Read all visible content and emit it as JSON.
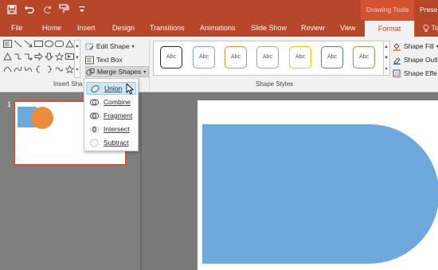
{
  "quick_access": {
    "save_icon": "save-icon",
    "undo_icon": "undo-icon",
    "redo_icon": "redo-icon",
    "format_painter_icon": "format-painter-icon",
    "customize_icon": "customize-qat-icon"
  },
  "contextual_tab_group": "Drawing Tools",
  "window_title_partial": "Prese",
  "tabs": [
    {
      "label": "File"
    },
    {
      "label": "Home"
    },
    {
      "label": "Insert"
    },
    {
      "label": "Design"
    },
    {
      "label": "Transitions"
    },
    {
      "label": "Animations"
    },
    {
      "label": "Slide Show"
    },
    {
      "label": "Review"
    },
    {
      "label": "View"
    },
    {
      "label": "Format"
    }
  ],
  "active_tab": "Format",
  "tell_me": {
    "label": "Te",
    "icon": "lightbulb-icon"
  },
  "ribbon": {
    "insert_shapes": {
      "group_label": "Insert Sha",
      "edit_shape": "Edit Shape",
      "text_box": "Text Box",
      "merge_shapes": "Merge Shapes"
    },
    "shape_styles": {
      "group_label": "Shape Styles",
      "swatch_label": "Abc",
      "swatch_colors": [
        "#262626",
        "#6da9dc",
        "#ed8b3a",
        "#a5a5a5",
        "#ffc000",
        "#4a7cc1",
        "#70ad47"
      ]
    },
    "right_commands": {
      "shape_fill": "Shape Fill",
      "shape_outline": "Shape Outl",
      "shape_effects": "Shape Effe"
    }
  },
  "merge_menu": {
    "items": [
      {
        "label": "Union",
        "icon": "union-icon"
      },
      {
        "label": "Combine",
        "icon": "combine-icon"
      },
      {
        "label": "Fragment",
        "icon": "fragment-icon"
      },
      {
        "label": "Intersect",
        "icon": "intersect-icon"
      },
      {
        "label": "Subtract",
        "icon": "subtract-icon"
      }
    ],
    "hovered": "Union"
  },
  "slides": {
    "current_number": "1"
  },
  "colors": {
    "accent": "#b7472a",
    "contextual_tab": "#d35230",
    "shape_blue": "#6da9dc",
    "shape_orange": "#ed8b3a"
  }
}
